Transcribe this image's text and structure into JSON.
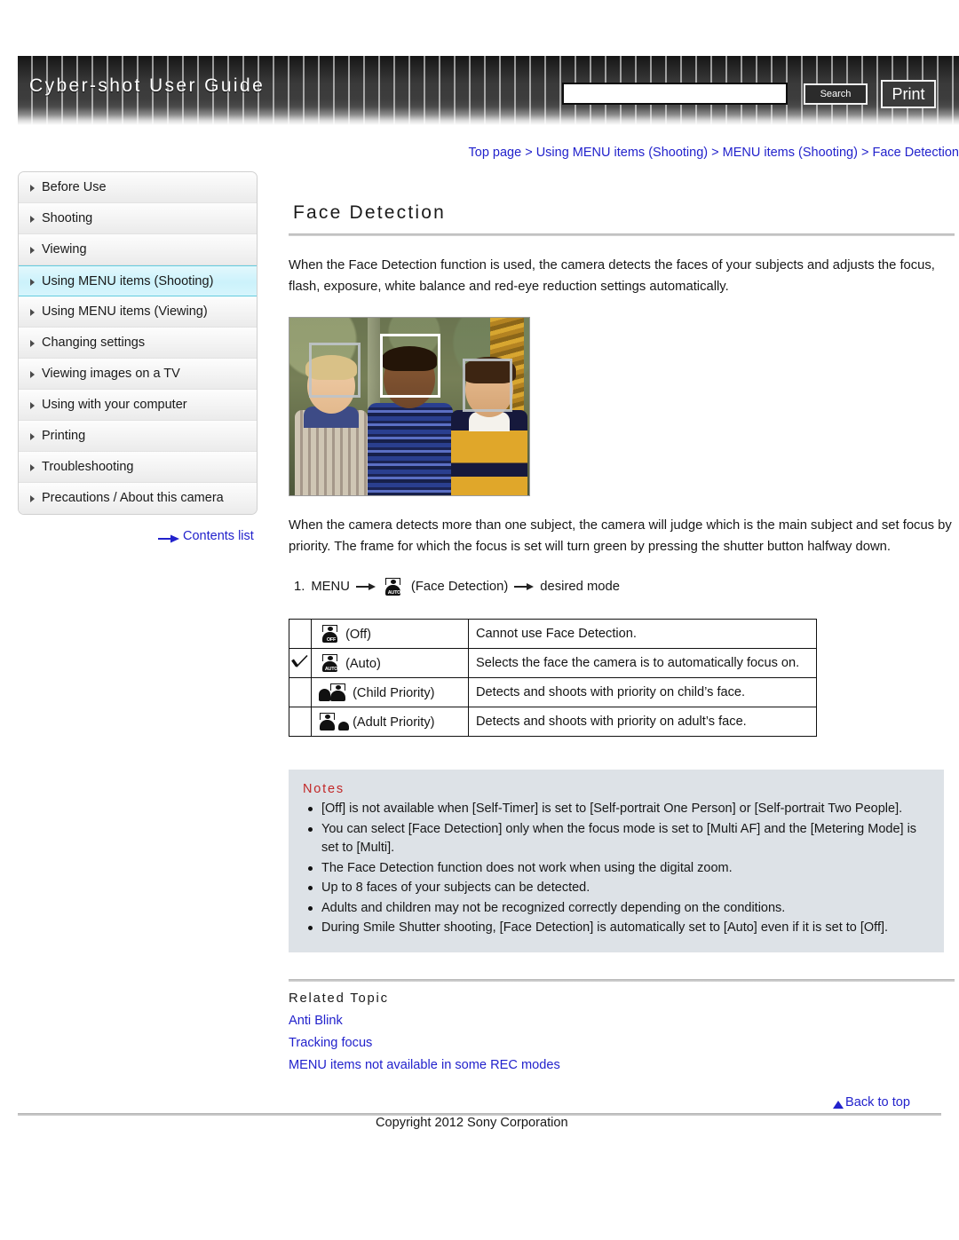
{
  "header": {
    "title": "Cyber-shot User Guide",
    "search": {
      "value": "",
      "placeholder": ""
    },
    "search_label": "Search",
    "print_label": "Print"
  },
  "breadcrumb": {
    "items": [
      "Top page",
      "Using MENU items (Shooting)",
      "MENU items (Shooting)",
      "Face Detection"
    ],
    "separator": ">",
    "full": "Top page > Using MENU items (Shooting) > MENU items (Shooting) > Face Detection"
  },
  "sidebar": {
    "items": [
      {
        "label": "Before Use",
        "active": false
      },
      {
        "label": "Shooting",
        "active": false
      },
      {
        "label": "Viewing",
        "active": false
      },
      {
        "label": "Using MENU items (Shooting)",
        "active": true
      },
      {
        "label": "Using MENU items (Viewing)",
        "active": false
      },
      {
        "label": "Changing settings",
        "active": false
      },
      {
        "label": "Viewing images on a TV",
        "active": false
      },
      {
        "label": "Using with your computer",
        "active": false
      },
      {
        "label": "Printing",
        "active": false
      },
      {
        "label": "Troubleshooting",
        "active": false
      },
      {
        "label": "Precautions / About this camera",
        "active": false
      }
    ],
    "contents_list_label": "Contents list",
    "contents_list_icon": "right-arrow-icon",
    "active_bg": "#ccf2fb",
    "active_border": "#63ccdf"
  },
  "main": {
    "title": "Face Detection",
    "paragraph1": "When the Face Detection function is used, the camera detects the faces of your subjects and adjusts the focus, flash, exposure, white balance and red-eye reduction settings automatically.",
    "photo": {
      "alt": "Three children photographed with three face detection frames; the center frame is white indicating the main subject",
      "frames": [
        {
          "subject": "left-child",
          "style": "gray"
        },
        {
          "subject": "center-child",
          "style": "white"
        },
        {
          "subject": "right-child",
          "style": "gray"
        }
      ]
    },
    "paragraph2": "When the camera detects more than one subject, the camera will judge which is the main subject and set focus by priority. The frame for which the focus is set will turn green by pressing the shutter button halfway down.",
    "step": {
      "number": "1.",
      "menu_label": "MENU",
      "icon": "face-detection-auto-icon",
      "icon_label": "(Face Detection)",
      "target": "desired mode",
      "arrow_icon": "right-arrow-icon"
    },
    "table": {
      "rows": [
        {
          "checked": false,
          "icon": "face-detection-off-icon",
          "icon_text": "OFF",
          "mode": "(Off)",
          "desc": "Cannot use Face Detection."
        },
        {
          "checked": true,
          "icon": "face-detection-auto-icon",
          "icon_text": "AUTO",
          "mode": "(Auto)",
          "desc": "Selects the face the camera is to automatically focus on."
        },
        {
          "checked": false,
          "icon": "child-priority-icon",
          "icon_text": "",
          "mode": "(Child Priority)",
          "desc": "Detects and shoots with priority on child’s face."
        },
        {
          "checked": false,
          "icon": "adult-priority-icon",
          "icon_text": "",
          "mode": "(Adult Priority)",
          "desc": "Detects and shoots with priority on adult’s face."
        }
      ],
      "check_icon": "checkmark-icon"
    },
    "notes": {
      "title": "Notes",
      "title_color": "#c22828",
      "background": "#dde2e7",
      "items": [
        "[Off] is not available when [Self-Timer] is set to [Self-portrait One Person] or [Self-portrait Two People].",
        "You can select [Face Detection] only when the focus mode is set to [Multi AF] and the [Metering Mode] is set to [Multi].",
        "The Face Detection function does not work when using the digital zoom.",
        "Up to 8 faces of your subjects can be detected.",
        "Adults and children may not be recognized correctly depending on the conditions.",
        "During Smile Shutter shooting, [Face Detection] is automatically set to [Auto] even if it is set to [Off]."
      ]
    },
    "related": {
      "title": "Related Topic",
      "links": [
        "Anti Blink",
        "Tracking focus",
        "MENU items not available in some REC modes"
      ]
    }
  },
  "footer": {
    "back_to_top": "Back to top",
    "back_to_top_icon": "up-triangle-icon",
    "copyright": "Copyright 2012 Sony Corporation"
  },
  "colors": {
    "link": "#2222cc",
    "header_dark": "#3a3a3a",
    "notes_bg": "#dde2e7",
    "notes_heading": "#c22828"
  }
}
